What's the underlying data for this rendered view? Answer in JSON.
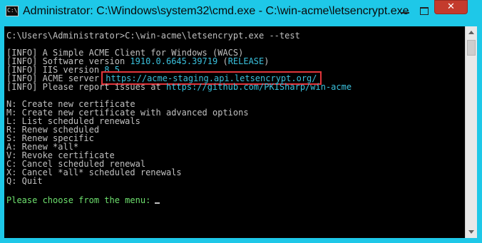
{
  "window": {
    "title": "Administrator: C:\\Windows\\system32\\cmd.exe - C:\\win-acme\\letsencrypt.exe",
    "icon_text": "C:\\.",
    "close_label": "✕"
  },
  "console": {
    "prompt": "C:\\Users\\Administrator>C:\\win-acme\\letsencrypt.exe --test",
    "info_lines": [
      {
        "tag": "[INFO]",
        "text": " A Simple ACME Client for Windows (WACS)"
      },
      {
        "tag": "[INFO]",
        "text": " Software version ",
        "value": "1910.0.6645.39719",
        "suffix": " (RELEASE)"
      },
      {
        "tag": "[INFO]",
        "text": " IIS version ",
        "value": "8.5"
      },
      {
        "tag": "[INFO]",
        "text": " ACME server ",
        "value": "https://acme-staging.api.letsencrypt.org/"
      },
      {
        "tag": "[INFO]",
        "text": " Please report issues at ",
        "value": "https://github.com/PKISharp/win-acme"
      }
    ],
    "menu": [
      {
        "key": "N:",
        "label": " Create new certificate"
      },
      {
        "key": "M:",
        "label": " Create new certificate with advanced options"
      },
      {
        "key": "L:",
        "label": " List scheduled renewals"
      },
      {
        "key": "R:",
        "label": " Renew scheduled"
      },
      {
        "key": "S:",
        "label": " Renew specific"
      },
      {
        "key": "A:",
        "label": " Renew *all*"
      },
      {
        "key": "V:",
        "label": " Revoke certificate"
      },
      {
        "key": "C:",
        "label": " Cancel scheduled renewal"
      },
      {
        "key": "X:",
        "label": " Cancel *all* scheduled renewals"
      },
      {
        "key": "Q:",
        "label": " Quit"
      }
    ],
    "choose_prompt": "Please choose from the menu:"
  },
  "colors": {
    "title_bar": "#1ec8e8",
    "console_bg": "#000000",
    "text": "#c0c0c0",
    "link": "#3ac0dc",
    "prompt_green": "#6ee06e",
    "highlight_box": "#e0353b",
    "close_button": "#c43b2d"
  },
  "icons": {
    "app": "cmd-icon",
    "minimize": "minimize-icon",
    "maximize": "maximize-icon",
    "close": "close-icon"
  }
}
